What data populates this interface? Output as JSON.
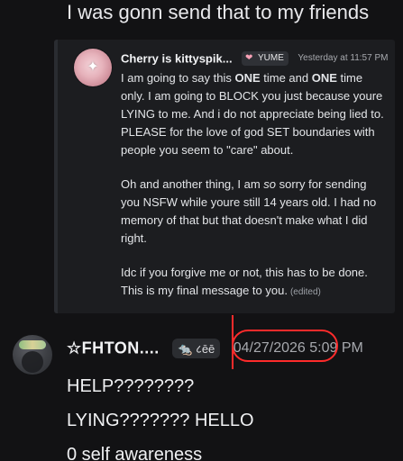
{
  "top_message": {
    "text": "I was gonn send that to my friends"
  },
  "quoted_message": {
    "avatar_icon": "sparkle-avatar",
    "username": "Cherry is kittyspik...",
    "role_tag": {
      "icon": "heart",
      "label": "YUME"
    },
    "timestamp": "Yesterday at 11:57 PM",
    "paragraphs": [
      {
        "parts": [
          {
            "text": "I am going to say this "
          },
          {
            "text": "ONE",
            "style": "bold"
          },
          {
            "text": " time and "
          },
          {
            "text": "ONE",
            "style": "bold"
          },
          {
            "text": " time only. I am going to BLOCK you just because youre LYING to me. And i do not appreciate being lied to.  PLEASE for the love of god SET boundaries with people you seem to \"care\" about."
          }
        ]
      },
      {
        "parts": [
          {
            "text": "Oh and another thing, I am "
          },
          {
            "text": "so",
            "style": "italic"
          },
          {
            "text": " sorry for sending you NSFW while youre still 14 years old. I had no memory of that but that doesn't make what I did right."
          }
        ]
      },
      {
        "parts": [
          {
            "text": "Idc if you forgive me or not, this has to be done. This is my final message to you."
          }
        ],
        "edited_label": "(edited)"
      }
    ]
  },
  "reply_message": {
    "username": "☆FHTON....",
    "badge_text": "🐀 ८ēē",
    "timestamp": "04/27/2026 5:09 PM",
    "lines": [
      "HELP????????",
      "LYING??????? HELLO",
      "0 self awareness"
    ]
  },
  "colors": {
    "background": "#121214",
    "annotation_red": "#ff2b2b",
    "quote_card": "#1c1d20"
  }
}
